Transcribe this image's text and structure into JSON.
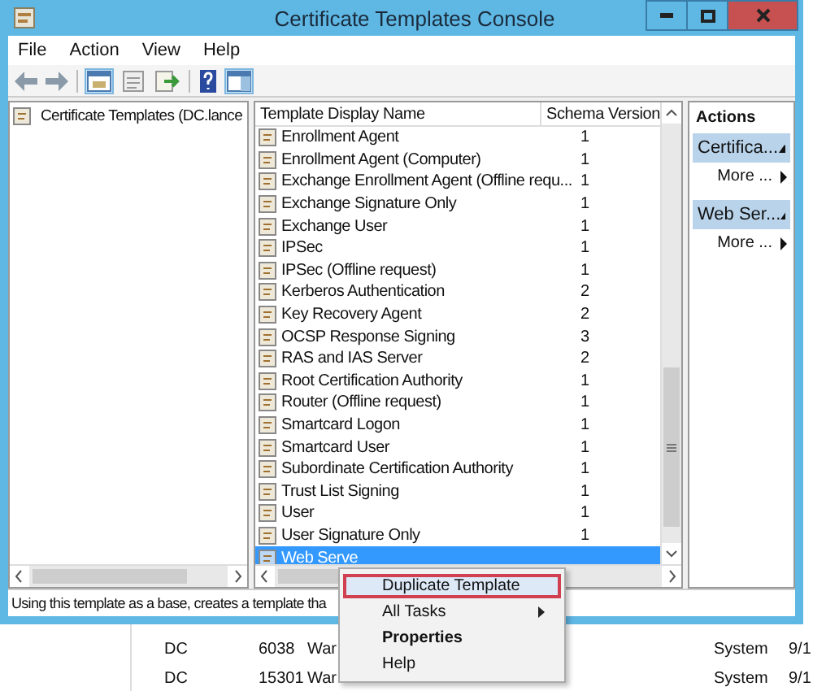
{
  "window": {
    "title": "Certificate Templates Console"
  },
  "menu": [
    "File",
    "Action",
    "View",
    "Help"
  ],
  "tree": {
    "items": [
      {
        "label": "Certificate Templates (DC.lance",
        "selected": false
      }
    ]
  },
  "table": {
    "columns": [
      "Template Display Name",
      "Schema Version"
    ],
    "rows": [
      {
        "name": "Enrollment Agent",
        "version": "1",
        "selected": false
      },
      {
        "name": "Enrollment Agent (Computer)",
        "version": "1",
        "selected": false
      },
      {
        "name": "Exchange Enrollment Agent (Offline requ...",
        "version": "1",
        "selected": false
      },
      {
        "name": "Exchange Signature Only",
        "version": "1",
        "selected": false
      },
      {
        "name": "Exchange User",
        "version": "1",
        "selected": false
      },
      {
        "name": "IPSec",
        "version": "1",
        "selected": false
      },
      {
        "name": "IPSec (Offline request)",
        "version": "1",
        "selected": false
      },
      {
        "name": "Kerberos Authentication",
        "version": "2",
        "selected": false
      },
      {
        "name": "Key Recovery Agent",
        "version": "2",
        "selected": false
      },
      {
        "name": "OCSP Response Signing",
        "version": "3",
        "selected": false
      },
      {
        "name": "RAS and IAS Server",
        "version": "2",
        "selected": false
      },
      {
        "name": "Root Certification Authority",
        "version": "1",
        "selected": false
      },
      {
        "name": "Router (Offline request)",
        "version": "1",
        "selected": false
      },
      {
        "name": "Smartcard Logon",
        "version": "1",
        "selected": false
      },
      {
        "name": "Smartcard User",
        "version": "1",
        "selected": false
      },
      {
        "name": "Subordinate Certification Authority",
        "version": "1",
        "selected": false
      },
      {
        "name": "Trust List Signing",
        "version": "1",
        "selected": false
      },
      {
        "name": "User",
        "version": "1",
        "selected": false
      },
      {
        "name": "User Signature Only",
        "version": "1",
        "selected": false
      },
      {
        "name": "Web Serve",
        "version": "",
        "selected": true
      }
    ]
  },
  "actions": {
    "title": "Actions",
    "sections": [
      {
        "title": "Certifica...",
        "items": [
          "More ..."
        ]
      },
      {
        "title": "Web Ser...",
        "items": [
          "More ..."
        ]
      }
    ]
  },
  "status_bar": "Using this template as a base, creates a template tha",
  "context_menu": [
    {
      "label": "Duplicate Template",
      "kind": "normal",
      "selected": true
    },
    {
      "label": "All Tasks",
      "kind": "submenu",
      "selected": false
    },
    {
      "label": "Properties",
      "kind": "default",
      "selected": false
    },
    {
      "label": "Help",
      "kind": "normal",
      "selected": false
    }
  ],
  "background_rows": [
    {
      "cells": [
        "DC",
        "6038",
        "War",
        "System",
        "9/1"
      ]
    },
    {
      "cells": [
        "DC",
        "15301",
        "War",
        "System",
        "9/1"
      ]
    }
  ]
}
